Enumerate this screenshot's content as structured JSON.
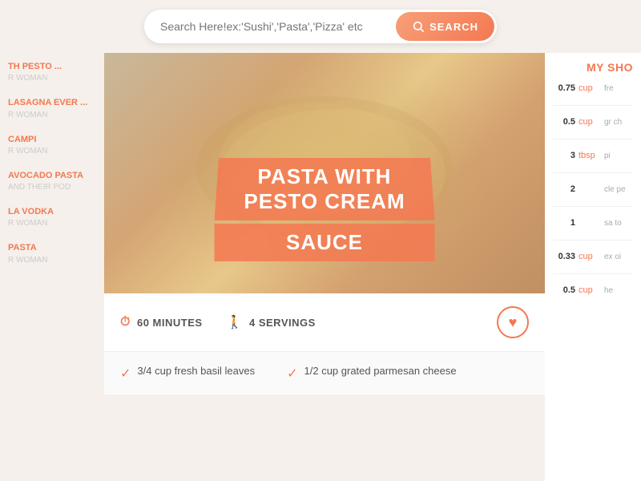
{
  "header": {
    "search_placeholder": "Search Here!ex:'Sushi','Pasta','Pizza' etc",
    "search_button_label": "SEARCH"
  },
  "logo": {
    "symbol": "🍴"
  },
  "sidebar": {
    "items": [
      {
        "title": "TH PESTO ...",
        "author": "R WOMAN"
      },
      {
        "title": "LASAGNA EVER ...",
        "author": "R WOMAN"
      },
      {
        "title": "CAMPI",
        "author": "R WOMAN"
      },
      {
        "title": "AVOCADO PASTA",
        "author": "AND THEIR POD"
      },
      {
        "title": "LA VODKA",
        "author": "R WOMAN"
      },
      {
        "title": "PASTA",
        "author": "R WOMAN"
      }
    ]
  },
  "recipe": {
    "title_line1": "PASTA WITH PESTO CREAM",
    "title_line2": "SAUCE",
    "time_label": "60 MINUTES",
    "servings_label": "4 SERVINGS",
    "ingredients_preview": [
      {
        "text": "3/4 cup fresh basil leaves"
      },
      {
        "text": "1/2 cup grated parmesan cheese"
      }
    ]
  },
  "right_sidebar": {
    "title": "MY SHO",
    "items": [
      {
        "qty": "0.75",
        "unit": "cup",
        "name": "fre"
      },
      {
        "qty": "0.5",
        "unit": "cup",
        "name": "gr ch"
      },
      {
        "qty": "3",
        "unit": "tbsp",
        "name": "pi"
      },
      {
        "qty": "2",
        "unit": "",
        "name": "cle pe"
      },
      {
        "qty": "1",
        "unit": "",
        "name": "sa to"
      },
      {
        "qty": "0.33",
        "unit": "cup",
        "name": "ex oi"
      },
      {
        "qty": "0.5",
        "unit": "cup",
        "name": "he"
      }
    ]
  }
}
